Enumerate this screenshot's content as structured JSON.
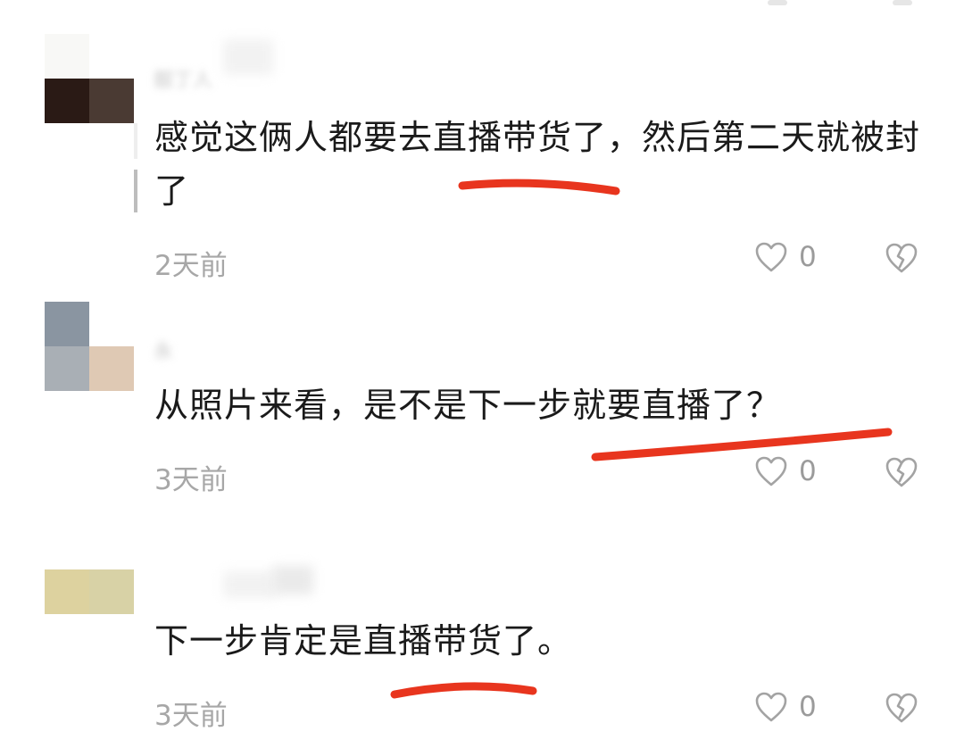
{
  "comments": [
    {
      "username": "靓丁人",
      "text": "感觉这俩人都要去直播带货了，然后第二天就被封了",
      "time": "2天前",
      "likes": "0",
      "avatar_colors": [
        "#f8f8f6",
        "#ffffff",
        "#2a1a15",
        "#4a3a33"
      ]
    },
    {
      "username": "永",
      "text": "从照片来看，是不是下一步就要直播了？",
      "time": "3天前",
      "likes": "0",
      "avatar_colors": [
        "#8a95a1",
        "#ffffff",
        "#a9afb5",
        "#dfc9b4"
      ]
    },
    {
      "username": "",
      "text": "下一步肯定是直播带货了。",
      "time": "3天前",
      "likes": "0",
      "avatar_colors": [
        "#ddd29f",
        "#d8d2a6",
        "#ffffff",
        "#ffffff"
      ]
    }
  ],
  "icons": {
    "like": "heart-outline-icon",
    "dislike": "broken-heart-icon"
  },
  "colors": {
    "highlight_underline": "#e8351e",
    "meta_text": "#a7a7a7",
    "icon": "#9b9b9b"
  }
}
